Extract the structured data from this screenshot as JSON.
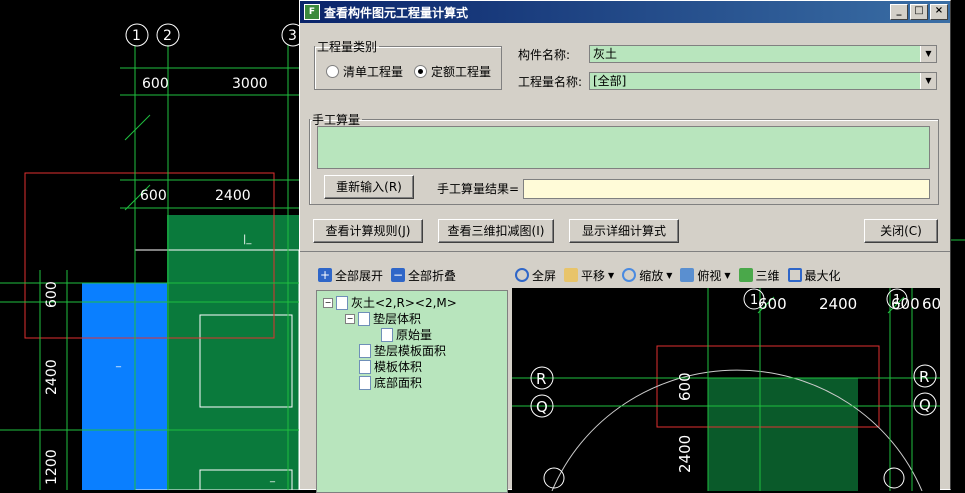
{
  "cad_bg": {
    "axis_labels": [
      "1",
      "2",
      "3"
    ],
    "dims_top": [
      "600",
      "3000"
    ],
    "dims_mid": [
      "600",
      "2400"
    ],
    "dims_left": [
      "600",
      "2400",
      "1200"
    ],
    "marks": [
      "|_",
      "_",
      "_"
    ]
  },
  "dialog": {
    "title": "查看构件图元工程量计算式",
    "controls": {
      "minimize": "_",
      "restore": "□",
      "close": "×"
    },
    "qty_group": {
      "legend": "工程量类别",
      "radio1": "清单工程量",
      "radio2": "定额工程量",
      "selected": "定额工程量"
    },
    "component_name_label": "构件名称:",
    "component_name_value": "灰土",
    "qty_name_label": "工程量名称:",
    "qty_name_value": "[全部]",
    "manual_group": {
      "legend": "手工算量",
      "reenter_button": "重新输入(R)",
      "result_label": "手工算量结果=",
      "result_value": ""
    },
    "buttons": {
      "rules": "查看计算规则(J)",
      "view3d": "查看三维扣减图(I)",
      "detail": "显示详细计算式",
      "close": "关闭(C)"
    },
    "tree_toolbar": {
      "expand_all": "全部展开",
      "collapse_all": "全部折叠"
    },
    "tree": {
      "root": "灰土<2,R><2,M>",
      "items": [
        "垫层体积",
        "原始量",
        "垫层模板面积",
        "模板体积",
        "底部面积"
      ]
    },
    "view_toolbar": {
      "fullscreen": "全屏",
      "pan": "平移",
      "zoom": "缩放",
      "topview": "俯视",
      "three_d": "三维",
      "maximize": "最大化"
    },
    "viewport": {
      "axis_top": [
        "1",
        "1"
      ],
      "dims": [
        "600",
        "2400",
        "600",
        "60"
      ],
      "row_labels": [
        "R",
        "Q",
        "R",
        "Q"
      ],
      "vdims": [
        "600",
        "2400"
      ]
    }
  },
  "colors": {
    "field_green": "#b8e5bd",
    "result_yellow": "#fffbd8",
    "cad_green": "#0a7a3c",
    "cad_blue": "#0a7fff"
  }
}
